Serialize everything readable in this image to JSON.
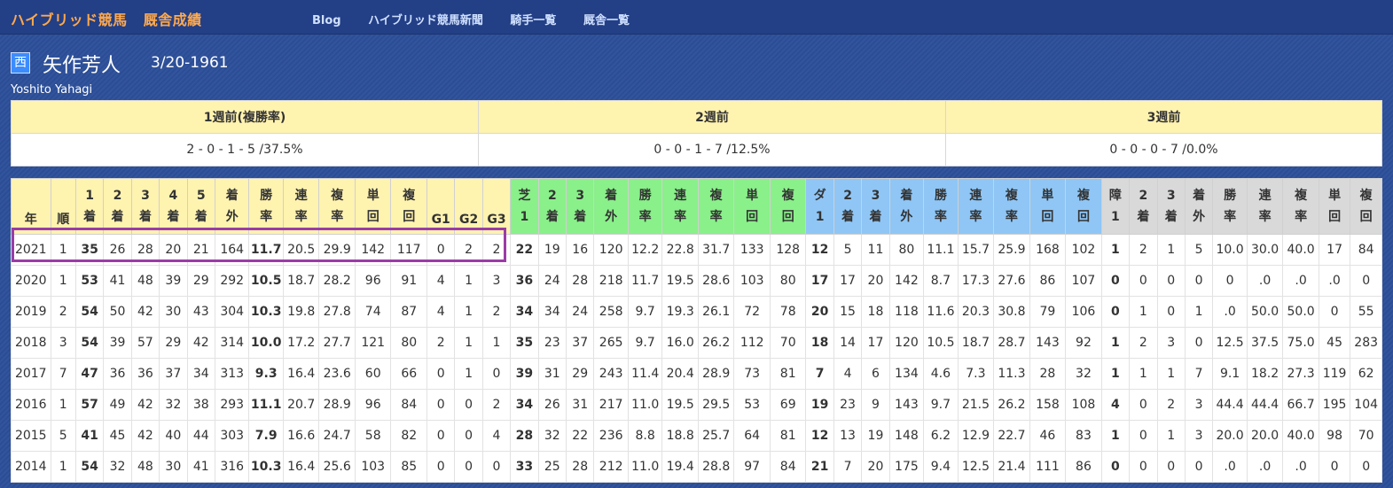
{
  "brand": {
    "title": "ハイブリッド競馬",
    "subtitle": "厩舎成績"
  },
  "nav": [
    "Blog",
    "ハイブリッド競馬新聞",
    "騎手一覧",
    "厩舎一覧"
  ],
  "trainer": {
    "region": "西",
    "name": "矢作芳人",
    "dob": "3/20-1961",
    "roman": "Yoshito Yahagi"
  },
  "weeks": {
    "headers": [
      "1週前(複勝率)",
      "2週前",
      "3週前"
    ],
    "values": [
      "2 - 0 - 1 - 5 /37.5%",
      "0 - 0 - 1 - 7 /12.5%",
      "0 - 0 - 0 - 7 /0.0%"
    ]
  },
  "columns": [
    [
      "年"
    ],
    [
      "順"
    ],
    [
      "1",
      "着"
    ],
    [
      "2",
      "着"
    ],
    [
      "3",
      "着"
    ],
    [
      "4",
      "着"
    ],
    [
      "5",
      "着"
    ],
    [
      "着",
      "外"
    ],
    [
      "勝",
      "率"
    ],
    [
      "連",
      "率"
    ],
    [
      "複",
      "率"
    ],
    [
      "単",
      "回"
    ],
    [
      "複",
      "回"
    ],
    [
      "G1"
    ],
    [
      "G2"
    ],
    [
      "G3"
    ],
    [
      "芝",
      "1"
    ],
    [
      "2",
      "着"
    ],
    [
      "3",
      "着"
    ],
    [
      "着",
      "外"
    ],
    [
      "勝",
      "率"
    ],
    [
      "連",
      "率"
    ],
    [
      "複",
      "率"
    ],
    [
      "単",
      "回"
    ],
    [
      "複",
      "回"
    ],
    [
      "ダ",
      "1"
    ],
    [
      "2",
      "着"
    ],
    [
      "3",
      "着"
    ],
    [
      "着",
      "外"
    ],
    [
      "勝",
      "率"
    ],
    [
      "連",
      "率"
    ],
    [
      "複",
      "率"
    ],
    [
      "単",
      "回"
    ],
    [
      "複",
      "回"
    ],
    [
      "障",
      "1"
    ],
    [
      "2",
      "着"
    ],
    [
      "3",
      "着"
    ],
    [
      "着",
      "外"
    ],
    [
      "勝",
      "率"
    ],
    [
      "連",
      "率"
    ],
    [
      "複",
      "率"
    ],
    [
      "単",
      "回"
    ],
    [
      "複",
      "回"
    ]
  ],
  "rows": [
    [
      "2021",
      "1",
      "35",
      "26",
      "28",
      "20",
      "21",
      "164",
      "11.7",
      "20.5",
      "29.9",
      "142",
      "117",
      "0",
      "2",
      "2",
      "22",
      "19",
      "16",
      "120",
      "12.2",
      "22.8",
      "31.7",
      "133",
      "128",
      "12",
      "5",
      "11",
      "80",
      "11.1",
      "15.7",
      "25.9",
      "168",
      "102",
      "1",
      "2",
      "1",
      "5",
      "10.0",
      "30.0",
      "40.0",
      "17",
      "84"
    ],
    [
      "2020",
      "1",
      "53",
      "41",
      "48",
      "39",
      "29",
      "292",
      "10.5",
      "18.7",
      "28.2",
      "96",
      "91",
      "4",
      "1",
      "3",
      "36",
      "24",
      "28",
      "218",
      "11.7",
      "19.5",
      "28.6",
      "103",
      "80",
      "17",
      "17",
      "20",
      "142",
      "8.7",
      "17.3",
      "27.6",
      "86",
      "107",
      "0",
      "0",
      "0",
      "0",
      "0",
      ".0",
      ".0",
      ".0",
      "0"
    ],
    [
      "2019",
      "2",
      "54",
      "50",
      "42",
      "30",
      "43",
      "304",
      "10.3",
      "19.8",
      "27.8",
      "74",
      "87",
      "4",
      "1",
      "2",
      "34",
      "34",
      "24",
      "258",
      "9.7",
      "19.3",
      "26.1",
      "72",
      "78",
      "20",
      "15",
      "18",
      "118",
      "11.6",
      "20.3",
      "30.8",
      "79",
      "106",
      "0",
      "1",
      "0",
      "1",
      ".0",
      "50.0",
      "50.0",
      "0",
      "55"
    ],
    [
      "2018",
      "3",
      "54",
      "39",
      "57",
      "29",
      "42",
      "314",
      "10.0",
      "17.2",
      "27.7",
      "121",
      "80",
      "2",
      "1",
      "1",
      "35",
      "23",
      "37",
      "265",
      "9.7",
      "16.0",
      "26.2",
      "112",
      "70",
      "18",
      "14",
      "17",
      "120",
      "10.5",
      "18.7",
      "28.7",
      "143",
      "92",
      "1",
      "2",
      "3",
      "0",
      "12.5",
      "37.5",
      "75.0",
      "45",
      "283"
    ],
    [
      "2017",
      "7",
      "47",
      "36",
      "36",
      "37",
      "34",
      "313",
      "9.3",
      "16.4",
      "23.6",
      "60",
      "66",
      "0",
      "1",
      "0",
      "39",
      "31",
      "29",
      "243",
      "11.4",
      "20.4",
      "28.9",
      "73",
      "81",
      "7",
      "4",
      "6",
      "134",
      "4.6",
      "7.3",
      "11.3",
      "28",
      "32",
      "1",
      "1",
      "1",
      "7",
      "9.1",
      "18.2",
      "27.3",
      "119",
      "62"
    ],
    [
      "2016",
      "1",
      "57",
      "49",
      "42",
      "32",
      "38",
      "293",
      "11.1",
      "20.7",
      "28.9",
      "96",
      "84",
      "0",
      "0",
      "2",
      "34",
      "26",
      "31",
      "217",
      "11.0",
      "19.5",
      "29.5",
      "53",
      "69",
      "19",
      "23",
      "9",
      "143",
      "9.7",
      "21.5",
      "26.2",
      "158",
      "108",
      "4",
      "0",
      "2",
      "3",
      "44.4",
      "44.4",
      "66.7",
      "195",
      "104"
    ],
    [
      "2015",
      "5",
      "41",
      "45",
      "42",
      "40",
      "44",
      "303",
      "7.9",
      "16.6",
      "24.7",
      "58",
      "82",
      "0",
      "0",
      "4",
      "28",
      "32",
      "22",
      "236",
      "8.8",
      "18.8",
      "25.7",
      "64",
      "81",
      "12",
      "13",
      "19",
      "148",
      "6.2",
      "12.9",
      "22.7",
      "46",
      "83",
      "1",
      "0",
      "1",
      "3",
      "20.0",
      "20.0",
      "40.0",
      "98",
      "70"
    ],
    [
      "2014",
      "1",
      "54",
      "32",
      "48",
      "30",
      "41",
      "316",
      "10.3",
      "16.4",
      "25.6",
      "103",
      "85",
      "0",
      "0",
      "0",
      "33",
      "25",
      "28",
      "212",
      "11.0",
      "19.4",
      "28.8",
      "97",
      "84",
      "21",
      "7",
      "20",
      "175",
      "9.4",
      "12.5",
      "21.4",
      "111",
      "86",
      "0",
      "0",
      "0",
      "0",
      ".0",
      ".0",
      ".0",
      "0",
      "0"
    ]
  ],
  "colors": {
    "accent": "#ffa94d",
    "highlight": "#9a3ca6",
    "turf": "#8af08a",
    "dirt": "#8fc6f5",
    "steeple": "#d9d9d9",
    "header": "#fff3b0"
  }
}
